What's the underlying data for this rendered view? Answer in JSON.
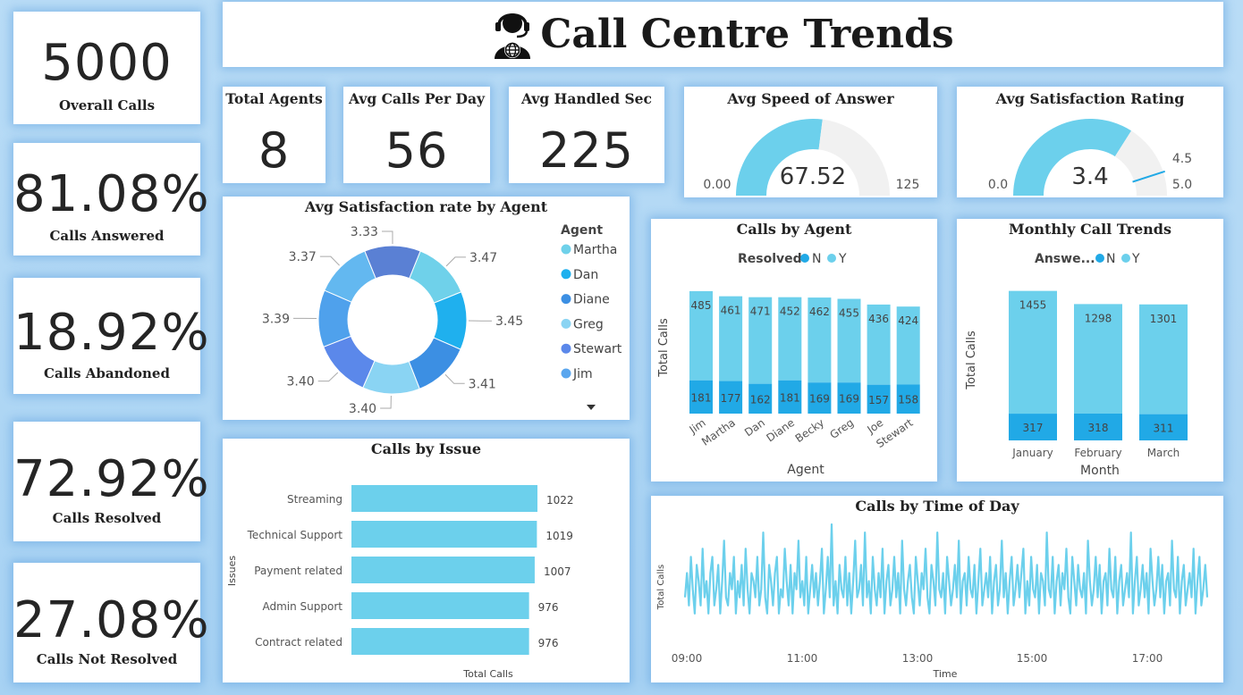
{
  "header": {
    "title": "Call Centre Trends",
    "icon": "call-centre-agent-icon"
  },
  "colors": {
    "light": "#6cd0ec",
    "dark": "#21a9e6",
    "gauge_track": "#f1f1f1"
  },
  "kpis": {
    "overall_calls": {
      "value": "5000",
      "label": "Overall Calls"
    },
    "calls_answered": {
      "value": "81.08%",
      "label": "Calls Answered"
    },
    "calls_abandoned": {
      "value": "18.92%",
      "label": "Calls Abandoned"
    },
    "calls_resolved": {
      "value": "72.92%",
      "label": "Calls Resolved"
    },
    "calls_not_resolved": {
      "value": "27.08%",
      "label": "Calls Not Resolved"
    },
    "total_agents": {
      "value": "8",
      "label": "Total Agents"
    },
    "avg_calls_per_day": {
      "value": "56",
      "label": "Avg Calls Per Day"
    },
    "avg_handled_sec": {
      "value": "225",
      "label": "Avg Handled Sec"
    }
  },
  "chart_data": [
    {
      "id": "speed_gauge",
      "type": "gauge",
      "title": "Avg Speed of Answer",
      "value": 67.52,
      "value_label": "67.52",
      "min": 0,
      "max": 125,
      "min_label": "0.00",
      "max_label": "125"
    },
    {
      "id": "satisfaction_gauge",
      "type": "gauge",
      "title": "Avg Satisfaction Rating",
      "value": 3.4,
      "value_label": "3.4",
      "min": 0,
      "max": 5,
      "min_label": "0.0",
      "max_label": "5.0",
      "target": 4.5,
      "target_label": "4.5"
    },
    {
      "id": "satisfaction_by_agent",
      "type": "pie",
      "title": "Avg Satisfaction rate by Agent",
      "legend_title": "Agent",
      "legend": [
        "Martha",
        "Dan",
        "Diane",
        "Greg",
        "Stewart",
        "Jim"
      ],
      "slices": [
        {
          "label": "3.47",
          "value": 3.47,
          "color": "#6fd1ea"
        },
        {
          "label": "3.45",
          "value": 3.45,
          "color": "#1fb0ee"
        },
        {
          "label": "3.41",
          "value": 3.41,
          "color": "#3c8fe3"
        },
        {
          "label": "3.40",
          "value": 3.4,
          "color": "#8ad4f3"
        },
        {
          "label": "3.40",
          "value": 3.4,
          "color": "#5b88ea"
        },
        {
          "label": "3.39",
          "value": 3.39,
          "color": "#4fa1ec"
        },
        {
          "label": "3.37",
          "value": 3.37,
          "color": "#63b8f0"
        },
        {
          "label": "3.33",
          "value": 3.33,
          "color": "#5a80d4"
        }
      ],
      "legend_colors": [
        "#6fd1ea",
        "#1fb0ee",
        "#3c8fe3",
        "#8ad4f3",
        "#5b88ea",
        "#5aa6ee"
      ]
    },
    {
      "id": "calls_by_agent",
      "type": "bar",
      "stacked": true,
      "title": "Calls by Agent",
      "legend_title": "Resolved",
      "xlabel": "Agent",
      "ylabel": "Total Calls",
      "categories": [
        "Jim",
        "Martha",
        "Dan",
        "Diane",
        "Becky",
        "Greg",
        "Joe",
        "Stewart"
      ],
      "series": [
        {
          "name": "N",
          "values": [
            181,
            177,
            162,
            181,
            169,
            169,
            157,
            158
          ]
        },
        {
          "name": "Y",
          "values": [
            485,
            461,
            471,
            452,
            462,
            455,
            436,
            424
          ]
        }
      ]
    },
    {
      "id": "monthly_trends",
      "type": "bar",
      "stacked": true,
      "title": "Monthly Call Trends",
      "legend_title": "Answe...",
      "xlabel": "Month",
      "ylabel": "Total Calls",
      "categories": [
        "January",
        "February",
        "March"
      ],
      "series": [
        {
          "name": "N",
          "values": [
            317,
            318,
            311
          ]
        },
        {
          "name": "Y",
          "values": [
            1455,
            1298,
            1301
          ]
        }
      ]
    },
    {
      "id": "calls_by_issue",
      "type": "bar",
      "orientation": "horizontal",
      "title": "Calls by Issue",
      "xlabel": "Total Calls",
      "ylabel": "Issues",
      "categories": [
        "Streaming",
        "Technical Support",
        "Payment related",
        "Admin Support",
        "Contract related"
      ],
      "values": [
        1022,
        1019,
        1007,
        976,
        976
      ]
    },
    {
      "id": "calls_by_time",
      "type": "line",
      "title": "Calls by Time of Day",
      "xlabel": "Time",
      "ylabel": "Total Calls",
      "xticks": [
        "09:00",
        "11:00",
        "13:00",
        "15:00",
        "17:00"
      ],
      "x_range": [
        "09:00",
        "17:50"
      ],
      "values": [
        4,
        7,
        3,
        9,
        5,
        2,
        8,
        6,
        3,
        10,
        4,
        6,
        2,
        7,
        9,
        3,
        5,
        8,
        2,
        6,
        11,
        4,
        3,
        7,
        5,
        9,
        2,
        6,
        4,
        8,
        3,
        10,
        5,
        2,
        7,
        6,
        4,
        9,
        3,
        5,
        12,
        4,
        2,
        8,
        6,
        3,
        7,
        9,
        2,
        5,
        4,
        10,
        6,
        3,
        8,
        2,
        7,
        5,
        11,
        4,
        6,
        3,
        9,
        2,
        5,
        8,
        4,
        7,
        3,
        6,
        10,
        2,
        5,
        9,
        4,
        13,
        3,
        6,
        2,
        8,
        5,
        4,
        9,
        3,
        7,
        2,
        6,
        11,
        4,
        5,
        8,
        3,
        12,
        4,
        6,
        2,
        9,
        5,
        3,
        7,
        4,
        10,
        2,
        6,
        8,
        3,
        5,
        9,
        4,
        7,
        2,
        11,
        5,
        3,
        6,
        8,
        4,
        2,
        9,
        6,
        3,
        7,
        5,
        10,
        4,
        2,
        8,
        6,
        3,
        12,
        5,
        4,
        7,
        2,
        9,
        6,
        3,
        5,
        8,
        4,
        11,
        2,
        6,
        7,
        3,
        9,
        5,
        4,
        8,
        2,
        6,
        10,
        3,
        5,
        7,
        4,
        9,
        2,
        6,
        8,
        3,
        5,
        11,
        4,
        7,
        2,
        6,
        9,
        3,
        5,
        8,
        4,
        7,
        10,
        2,
        6,
        3,
        9,
        5,
        4,
        8,
        2,
        7,
        6,
        3,
        12,
        5,
        4,
        9,
        2,
        6,
        8,
        3,
        7,
        5,
        10,
        4,
        2,
        9,
        6,
        3,
        8,
        5,
        4,
        7,
        2,
        11,
        6,
        3,
        5,
        9,
        4,
        8,
        2,
        6,
        7,
        3,
        10,
        5,
        4,
        9,
        2,
        6,
        8,
        3,
        5,
        7,
        4,
        12,
        2,
        6,
        9,
        3,
        5,
        8,
        4,
        7,
        2,
        10,
        6,
        3,
        5,
        9,
        4,
        8,
        2,
        6,
        7,
        3,
        11,
        5,
        4,
        9,
        2,
        6,
        8,
        3,
        5,
        7,
        4,
        10,
        2,
        6,
        9,
        3,
        5,
        8,
        4
      ]
    }
  ],
  "misc": {
    "legend_scroll_icon": "caret-down-icon"
  }
}
